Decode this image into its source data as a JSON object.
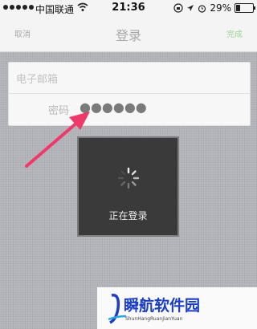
{
  "status_bar": {
    "carrier": "中国联通",
    "time": "21:36",
    "battery": "29%",
    "battery_level": 0.29
  },
  "nav": {
    "cancel_label": "取消",
    "title": "登录",
    "done_label": "完成"
  },
  "form": {
    "email_placeholder": "电子邮箱",
    "password_label": "密码",
    "password_value": "●●●●●●"
  },
  "loading": {
    "message": "正在登录"
  },
  "watermark": {
    "title": "瞬航软件园",
    "subtitle": "ShunHangRuanJianYuan"
  },
  "colors": {
    "arrow": "#ee3a6b",
    "done": "#9dd69a",
    "watermark": "#1a3ec5"
  },
  "icons": [
    "signal-icon",
    "wifi-icon",
    "lock-rotation-icon",
    "location-icon",
    "alarm-icon",
    "battery-icon",
    "spinner-icon",
    "arrow-icon",
    "watermark-logo-icon"
  ]
}
